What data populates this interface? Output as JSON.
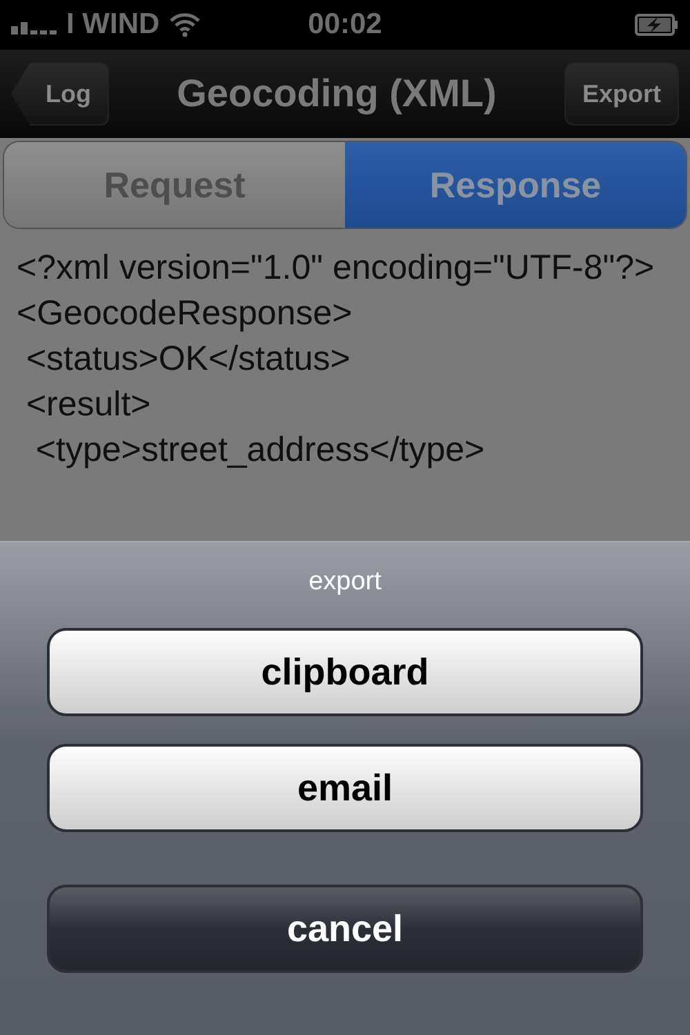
{
  "status_bar": {
    "carrier": "I WIND",
    "time": "00:02"
  },
  "nav": {
    "back": "Log",
    "title": "Geocoding (XML)",
    "action": "Export"
  },
  "segments": [
    {
      "label": "Request",
      "selected": false
    },
    {
      "label": "Response",
      "selected": true
    }
  ],
  "xml_lines": [
    "<?xml version=\"1.0\" encoding=\"UTF-8\"?>",
    "<GeocodeResponse>",
    " <status>OK</status>",
    " <result>",
    "  <type>street_address</type>"
  ],
  "action_sheet": {
    "title": "export",
    "buttons": [
      {
        "label": "clipboard",
        "kind": "default"
      },
      {
        "label": "email",
        "kind": "default"
      },
      {
        "label": "cancel",
        "kind": "cancel"
      }
    ]
  }
}
